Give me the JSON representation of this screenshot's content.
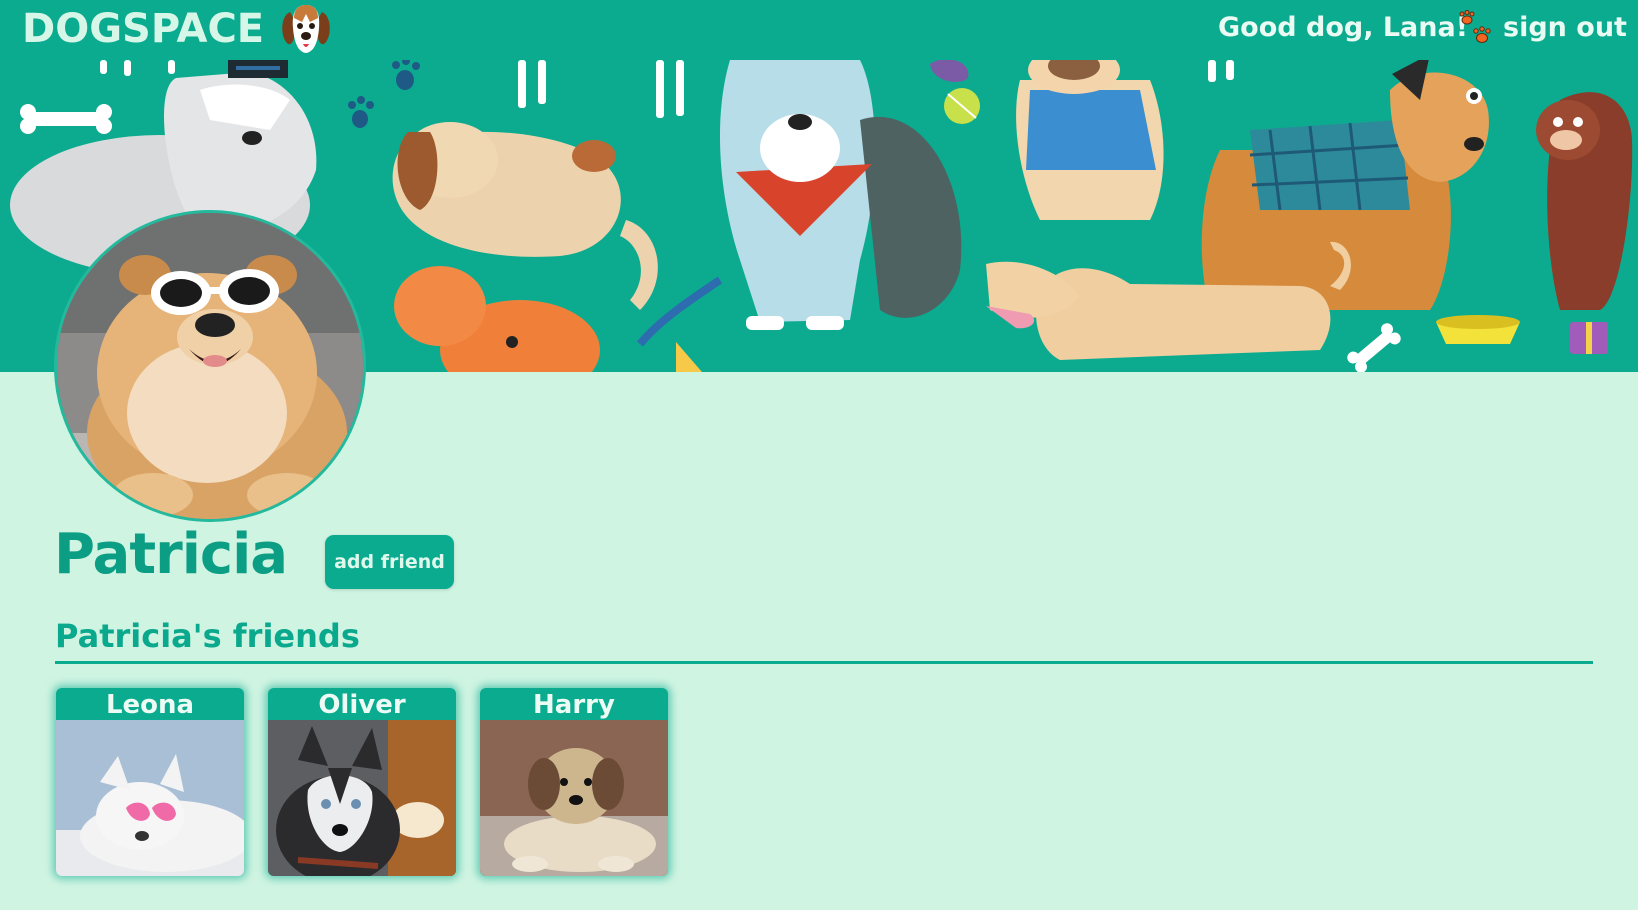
{
  "header": {
    "brand": "DOGSPACE",
    "brand_icon": "beagle-dog-face-icon",
    "greeting": "Good dog, Lana!",
    "paw_icon": "paw-prints-icon",
    "sign_out_label": "sign out"
  },
  "profile": {
    "name": "Patricia",
    "add_friend_label": "add friend",
    "friends_heading": "Patricia's friends"
  },
  "friends": [
    {
      "name": "Leona"
    },
    {
      "name": "Oliver"
    },
    {
      "name": "Harry"
    }
  ],
  "colors": {
    "primary_teal": "#0aab8f",
    "page_background": "#cff4e2",
    "heading_teal": "#0b9e85",
    "light_text": "#e9fbf2"
  }
}
